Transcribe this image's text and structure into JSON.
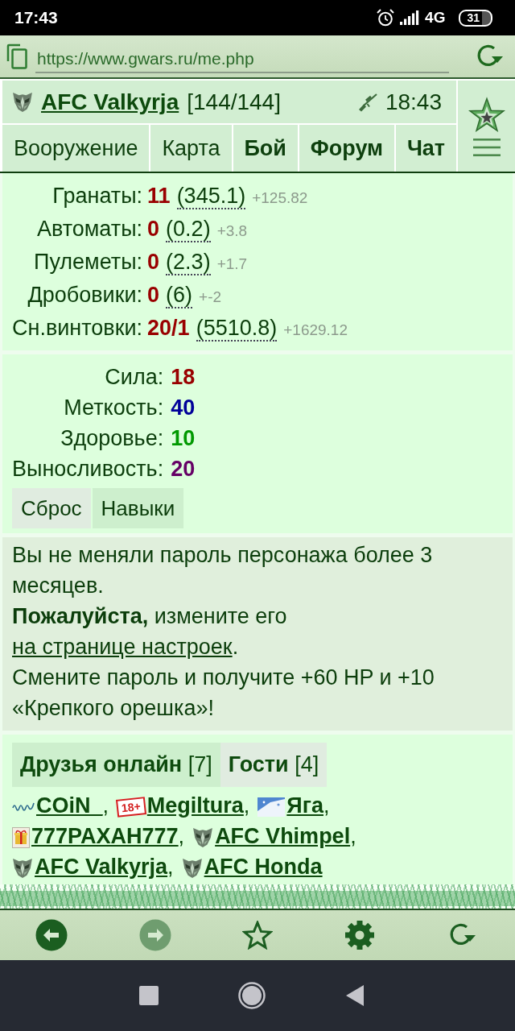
{
  "status_bar": {
    "time": "17:43",
    "network": "4G",
    "battery": "31"
  },
  "browser_bar": {
    "url": "https://www.gwars.ru/me.php"
  },
  "header": {
    "player": "AFC Valkyrja",
    "hp": "[144/144]",
    "time": "18:43",
    "nav": [
      {
        "label": "Вооружение",
        "emphasized": false
      },
      {
        "label": "Карта",
        "emphasized": false
      },
      {
        "label": "Бой",
        "emphasized": true
      },
      {
        "label": "Форум",
        "emphasized": true
      },
      {
        "label": "Чат",
        "emphasized": true
      }
    ]
  },
  "skills": [
    {
      "label": "Гранаты:",
      "value": "11",
      "total": "(345.1)",
      "delta": "+125.82"
    },
    {
      "label": "Автоматы:",
      "value": "0",
      "total": "(0.2)",
      "delta": "+3.8"
    },
    {
      "label": "Пулеметы:",
      "value": "0",
      "total": "(2.3)",
      "delta": "+1.7"
    },
    {
      "label": "Дробовики:",
      "value": "0",
      "total": "(6)",
      "delta": "+-2"
    },
    {
      "label": "Сн.винтовки:",
      "value": "20/1",
      "total": "(5510.8)",
      "delta": "+1629.12"
    }
  ],
  "stats": [
    {
      "label": "Сила:",
      "value": "18",
      "color": "#990000"
    },
    {
      "label": "Меткость:",
      "value": "40",
      "color": "#000099"
    },
    {
      "label": "Здоровье:",
      "value": "10",
      "color": "#009900"
    },
    {
      "label": "Выносливость:",
      "value": "20",
      "color": "#660066"
    }
  ],
  "stat_buttons": [
    {
      "label": "Сброс",
      "kind": "plain"
    },
    {
      "label": "Навыки",
      "kind": "accent"
    }
  ],
  "notice": {
    "warning": "Вы не меняли пароль персонажа более 3 месяцев.",
    "request": "**Пожалуйста,** измените его",
    "link": "на странице настроек",
    "link_end": ".",
    "reward": "Смените пароль и получите +60 HP и +10 «Крепкого орешка»!"
  },
  "friends": {
    "tabs": [
      {
        "label": "Друзья онлайн",
        "count": "[7]",
        "selected": true
      },
      {
        "label": "Гости",
        "count": "[4]",
        "selected": false
      }
    ],
    "list": [
      {
        "name": "COiN_",
        "kind": "scribble",
        "separator": ","
      },
      {
        "name": "Megiltura",
        "kind": "age_badge",
        "badge": "18+",
        "separator": ","
      },
      {
        "name": "Яга",
        "kind": "snow_picture",
        "separator": ","
      },
      {
        "name": "777PAXAH777",
        "kind": "gift",
        "separator": ","
      },
      {
        "name": "AFC Vhimpel",
        "kind": "emblem",
        "separator": ","
      },
      {
        "name": "AFC Valkyrja",
        "kind": "emblem",
        "separator": ","
      },
      {
        "name": "AFC Honda",
        "kind": "emblem"
      }
    ]
  },
  "toolbar": [
    {
      "kind": "back",
      "disabled": false
    },
    {
      "kind": "forward",
      "disabled": true
    },
    {
      "kind": "bookmark",
      "disabled": false
    },
    {
      "kind": "settings",
      "disabled": false
    },
    {
      "kind": "reload",
      "disabled": false
    }
  ]
}
